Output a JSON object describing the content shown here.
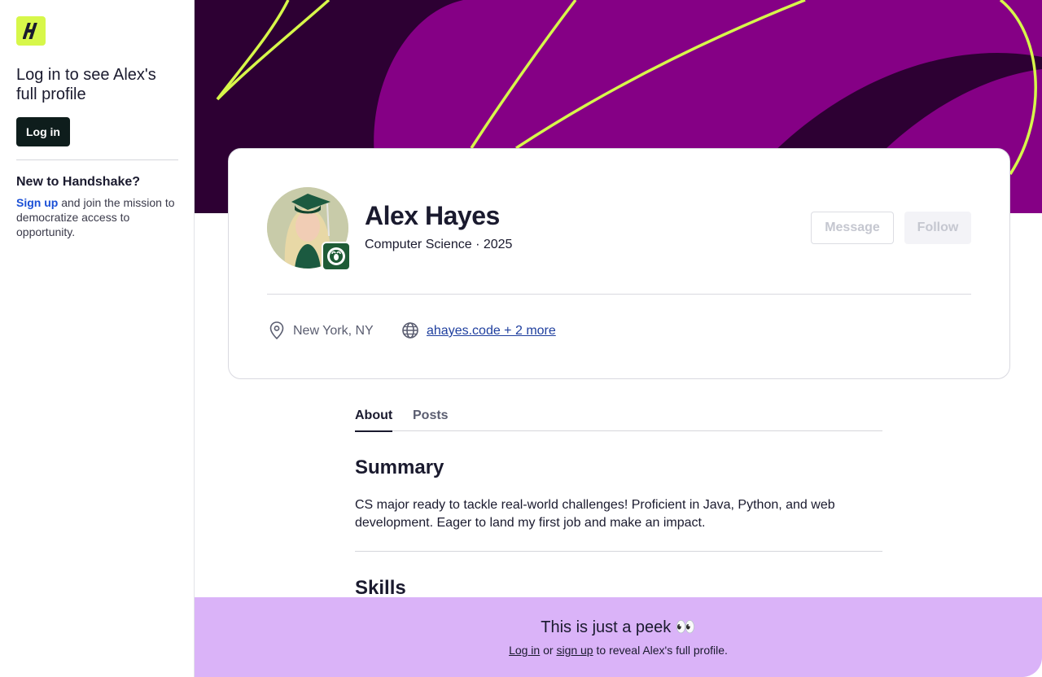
{
  "sidebar": {
    "logo_letter": "H",
    "title": "Log in to see Alex's full profile",
    "login_label": "Log in",
    "new_heading": "New to Handshake?",
    "signup_link": "Sign up",
    "signup_rest": " and join the mission to democratize access to opportunity."
  },
  "profile": {
    "name": "Alex Hayes",
    "subtitle": "Computer Science · 2025",
    "message_label": "Message",
    "follow_label": "Follow",
    "location": "New York, NY",
    "links": "ahayes.code + 2 more"
  },
  "tabs": [
    {
      "label": "About",
      "active": true
    },
    {
      "label": "Posts",
      "active": false
    }
  ],
  "about": {
    "summary_title": "Summary",
    "summary_text": "CS major ready to tackle real-world challenges! Proficient in Java, Python, and web development. Eager to land my first job and make an impact.",
    "skills_title": "Skills"
  },
  "peek": {
    "title": "This is just a peek 👀",
    "login_link": "Log in",
    "or_text": " or ",
    "signup_link": "sign up",
    "rest_text": " to reveal Alex's full profile."
  },
  "colors": {
    "brand_lime": "#d7f74a",
    "banner_dark": "#2d0033",
    "banner_purple": "#850085",
    "peek_bg": "#dab3f8",
    "link_blue": "#1a4fd6"
  },
  "icons": [
    "handshake-logo-icon",
    "location-pin-icon",
    "globe-icon",
    "school-ram-icon"
  ]
}
